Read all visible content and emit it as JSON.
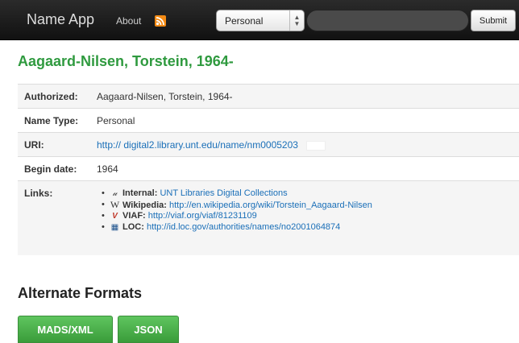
{
  "nav": {
    "brand": "Name App",
    "about": "About",
    "rss_icon": "rss-icon",
    "select_value": "Personal",
    "search_value": "",
    "submit_label": "Submit"
  },
  "title": "Aagaard-Nilsen, Torstein, 1964-",
  "details": {
    "authorized_label": "Authorized:",
    "authorized_value": "Aagaard-Nilsen, Torstein, 1964-",
    "name_type_label": "Name Type:",
    "name_type_value": "Personal",
    "uri_label": "URI:",
    "uri_value": "http:// digital2.library.unt.edu/name/nm0005203",
    "begin_date_label": "Begin date:",
    "begin_date_value": "1964",
    "links_label": "Links:"
  },
  "links": [
    {
      "icon": "unt-icon",
      "glyph": "𝓊",
      "source": "Internal:",
      "text": "UNT Libraries Digital Collections"
    },
    {
      "icon": "wikipedia-icon",
      "glyph": "W",
      "source": "Wikipedia:",
      "text": "http://en.wikipedia.org/wiki/Torstein_Aagaard-Nilsen"
    },
    {
      "icon": "viaf-icon",
      "glyph": "V",
      "source": "VIAF:",
      "text": "http://viaf.org/viaf/81231109"
    },
    {
      "icon": "loc-icon",
      "glyph": "▦",
      "source": "LOC:",
      "text": "http://id.loc.gov/authorities/names/no2001064874"
    }
  ],
  "alternate_formats": {
    "heading": "Alternate Formats",
    "mads_label": "MADS/XML",
    "json_label": "JSON"
  },
  "colors": {
    "title_green": "#2f9a3f",
    "link_blue": "#1a6fb8",
    "button_green": "#4cb14c",
    "navbar": "#1c1c1c"
  }
}
